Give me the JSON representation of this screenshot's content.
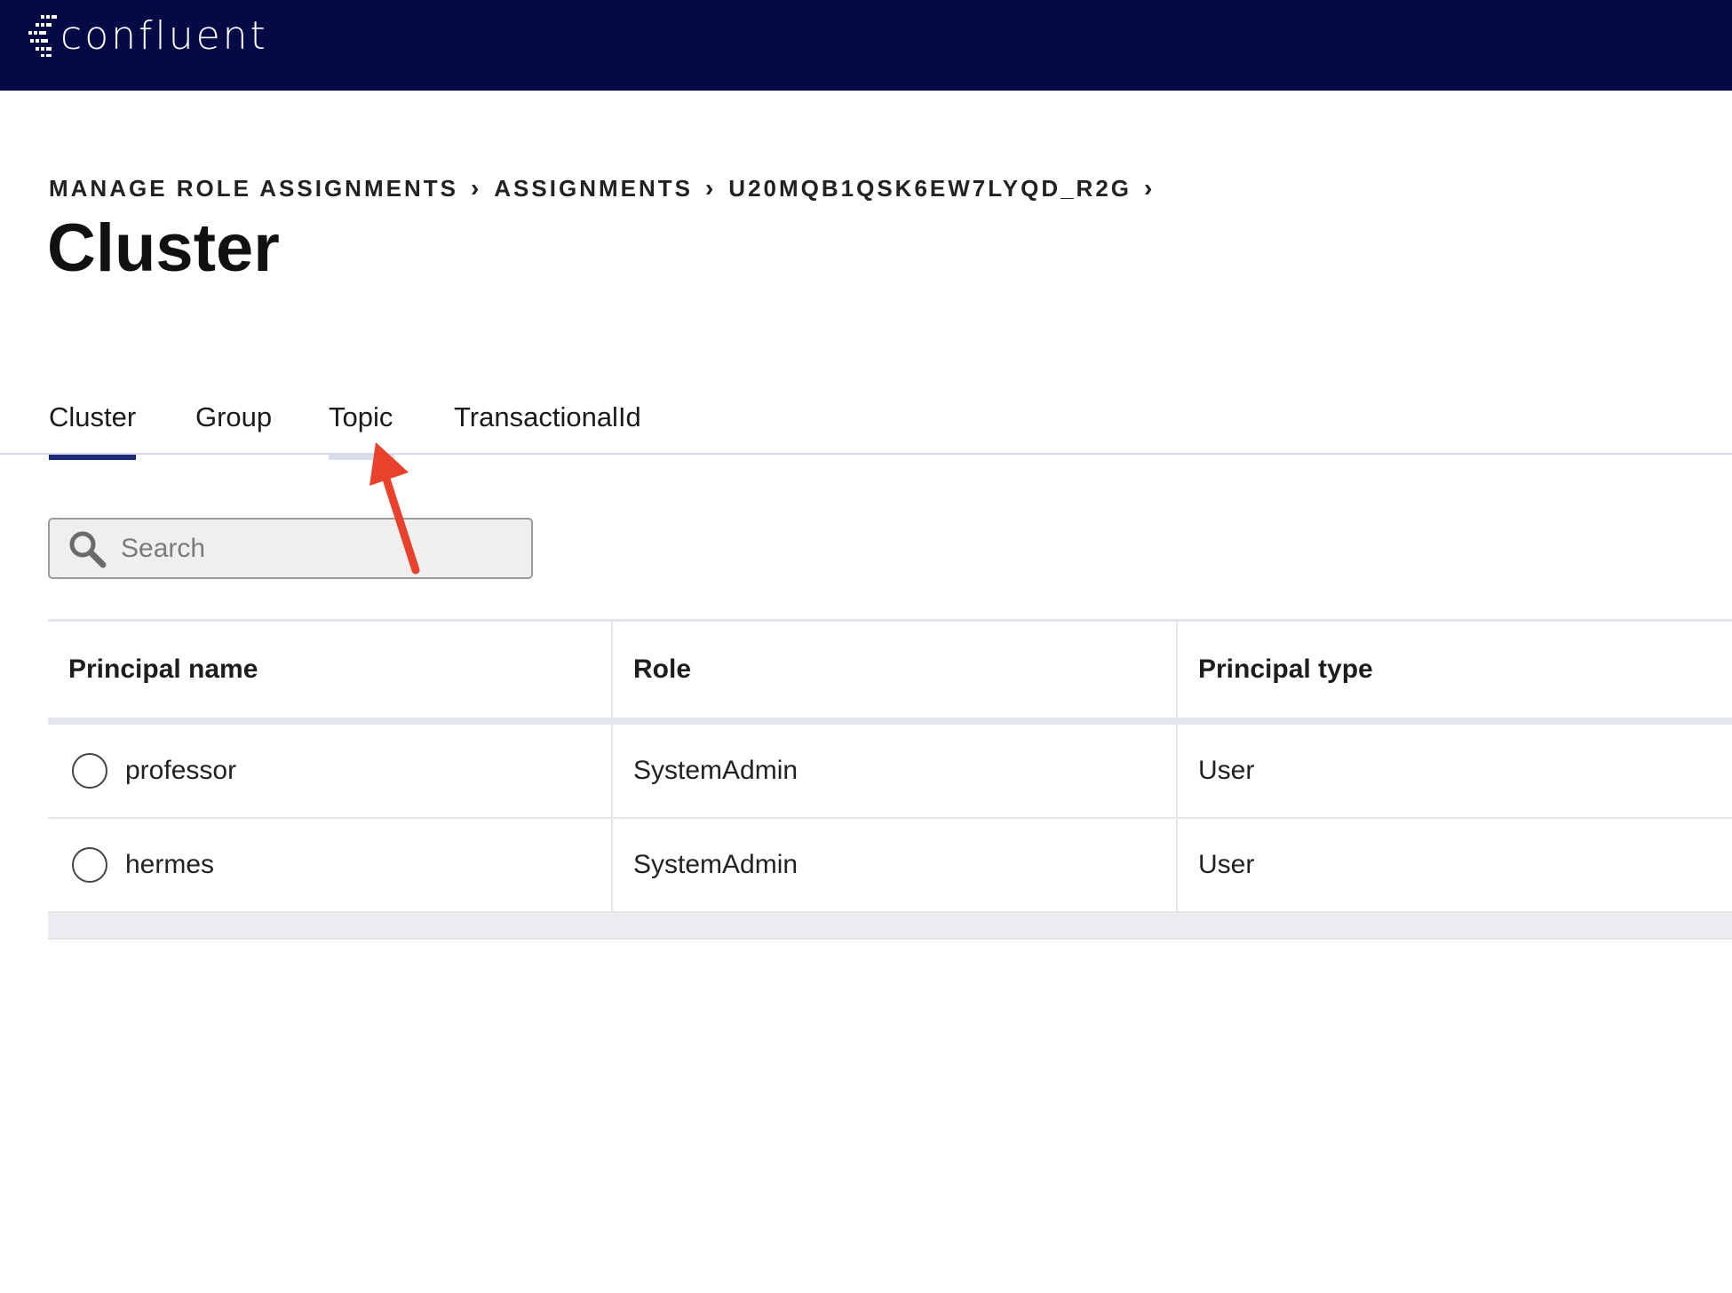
{
  "header": {
    "logo_text": "confluent",
    "background": "#040a45"
  },
  "breadcrumb": {
    "items": [
      "MANAGE ROLE ASSIGNMENTS",
      "ASSIGNMENTS",
      "U20MQB1QSK6EW7LYQD_R2G"
    ],
    "separator": "›"
  },
  "page": {
    "title": "Cluster"
  },
  "tabs": [
    {
      "label": "Cluster",
      "active": true
    },
    {
      "label": "Group",
      "active": false
    },
    {
      "label": "Topic",
      "active": false,
      "hover": true
    },
    {
      "label": "TransactionalId",
      "active": false
    }
  ],
  "search": {
    "placeholder": "Search",
    "value": ""
  },
  "table": {
    "columns": [
      "Principal name",
      "Role",
      "Principal type"
    ],
    "rows": [
      {
        "principal": "professor",
        "role": "SystemAdmin",
        "type": "User"
      },
      {
        "principal": "hermes",
        "role": "SystemAdmin",
        "type": "User"
      }
    ]
  },
  "annotation": {
    "arrow_color": "#e8412c",
    "target": "Topic tab"
  },
  "colors": {
    "active_tab_underline": "#1c2a7c",
    "hover_tab_underline": "#d9dcea"
  }
}
